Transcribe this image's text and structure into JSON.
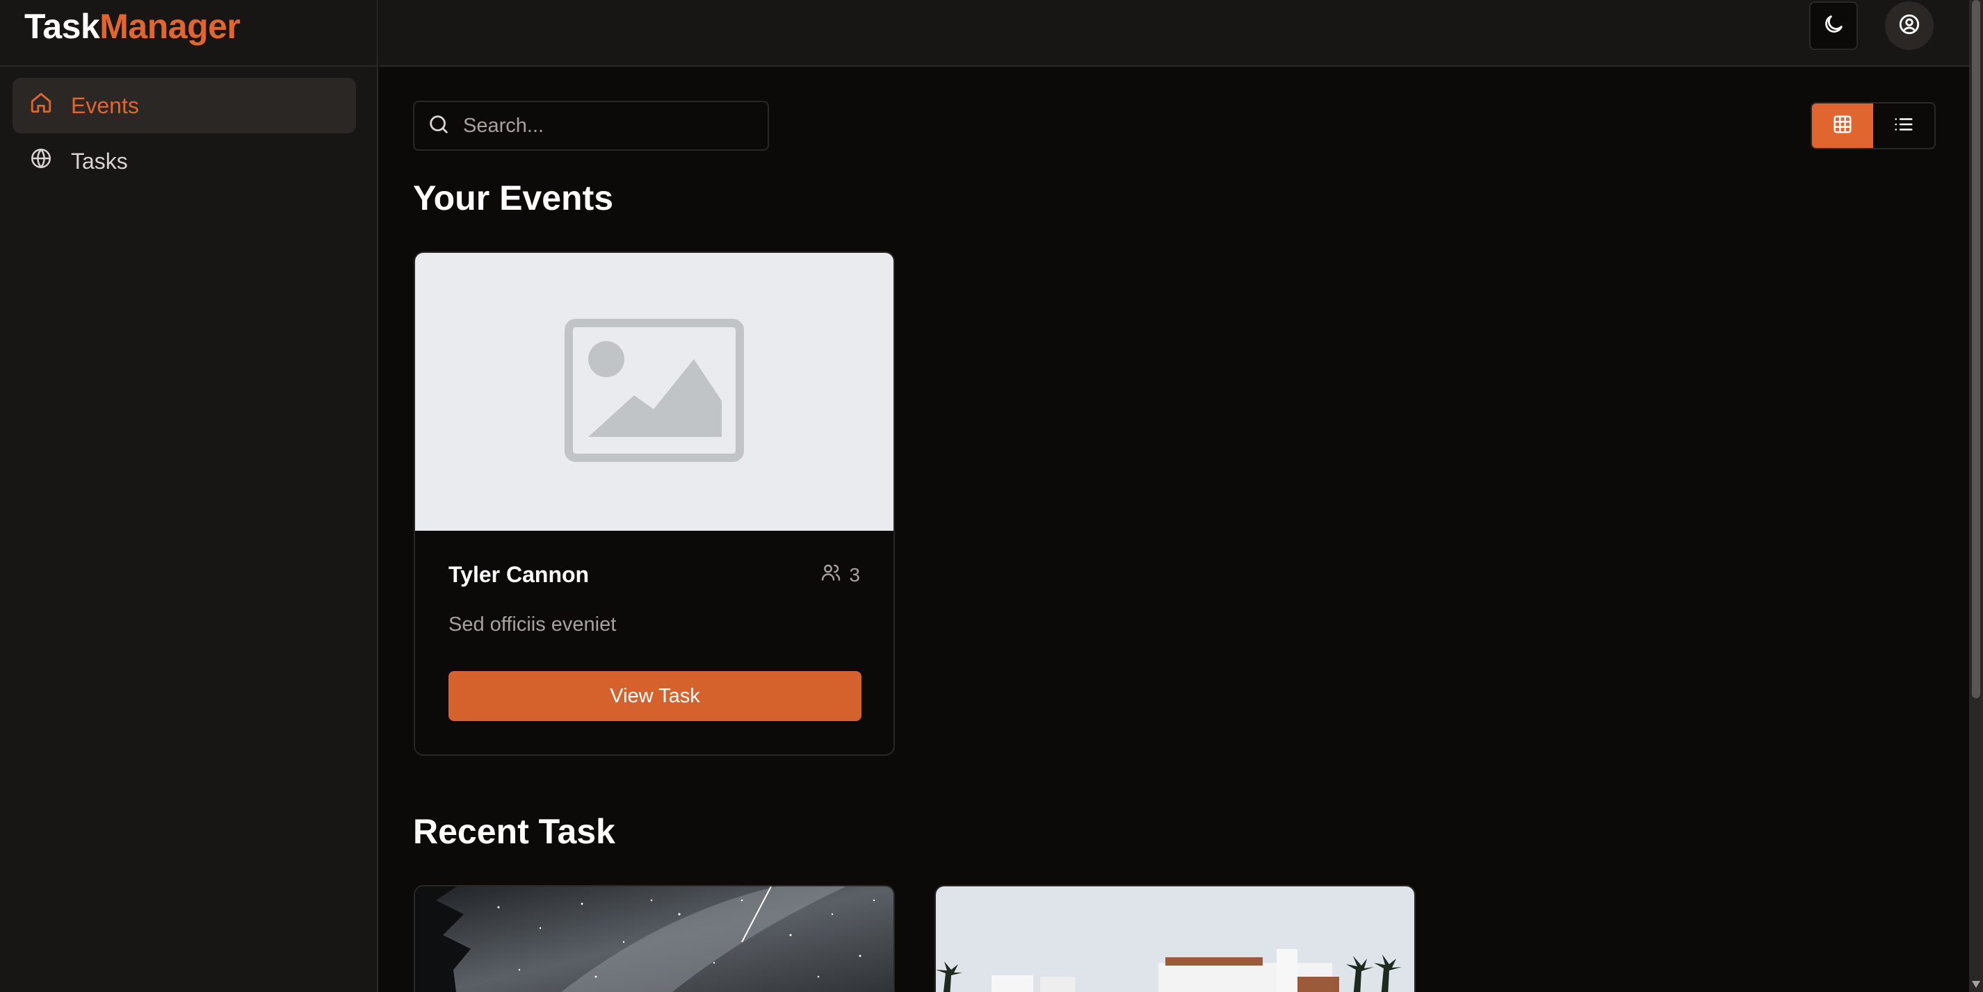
{
  "brand": {
    "part1": "Task",
    "part2": "Manager"
  },
  "sidebar": {
    "items": [
      {
        "label": "Events",
        "icon": "home-icon",
        "active": true
      },
      {
        "label": "Tasks",
        "icon": "globe-icon",
        "active": false
      }
    ]
  },
  "topbar": {
    "theme_icon": "moon-icon",
    "user_icon": "user-circle-icon"
  },
  "search": {
    "placeholder": "Search...",
    "value": ""
  },
  "view_toggle": {
    "active": "grid",
    "options": [
      "grid-icon",
      "list-icon"
    ]
  },
  "sections": {
    "your_events": "Your Events",
    "recent_task": "Recent Task"
  },
  "event_card": {
    "title": "Tyler Cannon",
    "members": "3",
    "description": "Sed officiis eveniet",
    "button": "View Task"
  },
  "colors": {
    "accent": "#e0652f",
    "background": "#0c0a09",
    "panel": "#171615"
  }
}
